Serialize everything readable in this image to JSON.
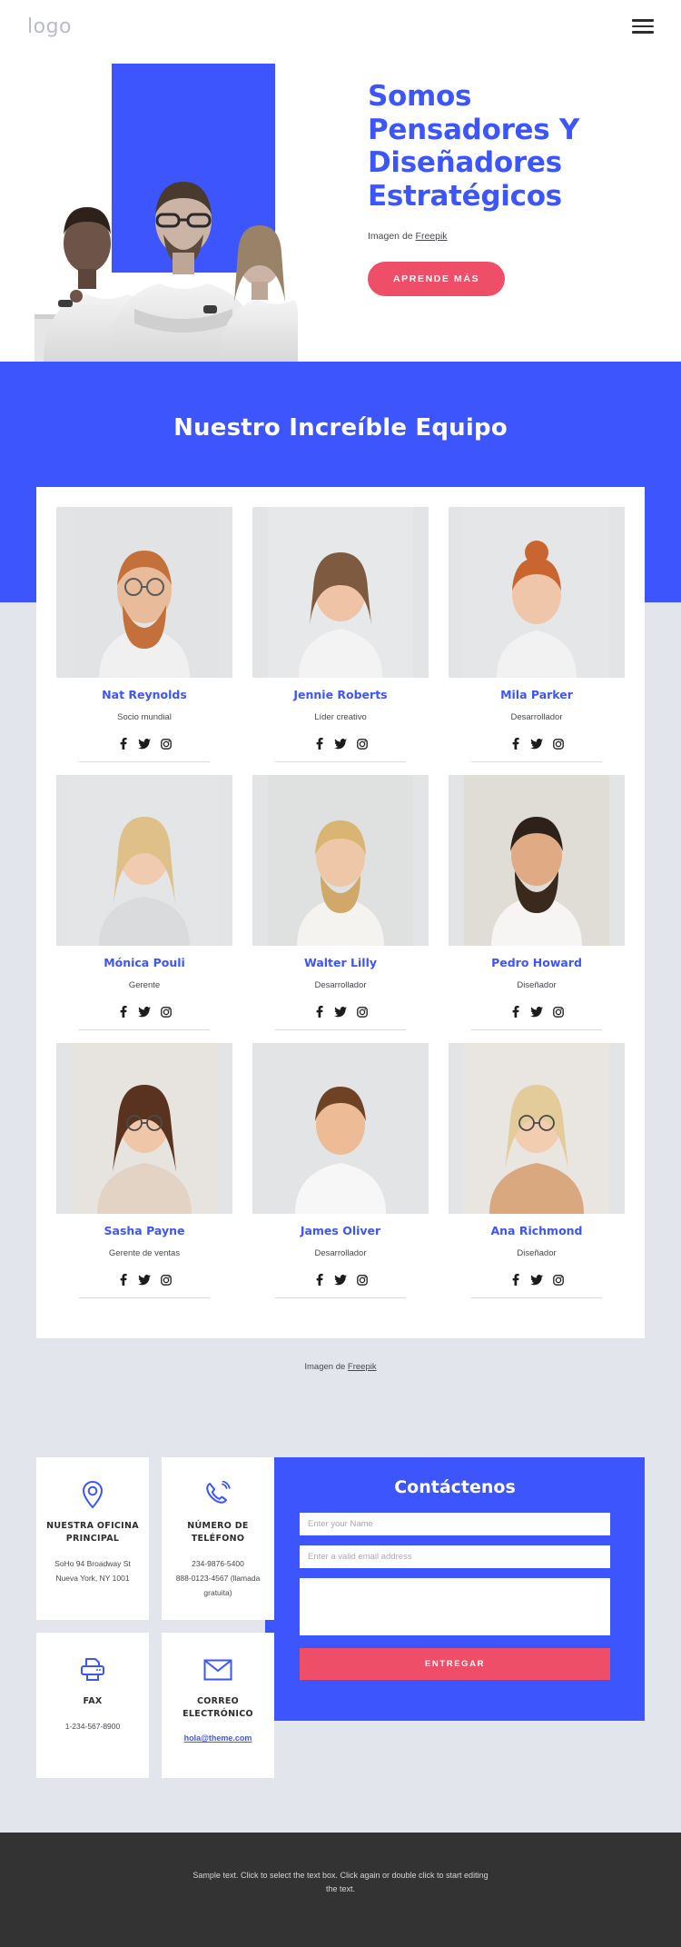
{
  "header": {
    "logo": "logo",
    "menu_icon": "hamburger-menu-icon"
  },
  "hero": {
    "title": "Somos Pensadores Y Diseñadores Estratégicos",
    "credit_prefix": "Imagen de ",
    "credit_link": "Freepik",
    "cta_label": "APRENDE MÁS"
  },
  "team": {
    "heading": "Nuestro Increíble Equipo",
    "credit_prefix": "Imagen de ",
    "credit_link": "Freepik",
    "social_icons": [
      "facebook-icon",
      "twitter-icon",
      "instagram-icon"
    ],
    "rows": [
      [
        {
          "name": "Nat Reynolds",
          "role": "Socio mundial"
        },
        {
          "name": "Jennie Roberts",
          "role": "Líder creativo"
        },
        {
          "name": "Mila Parker",
          "role": "Desarrollador"
        }
      ],
      [
        {
          "name": "Mónica Pouli",
          "role": "Gerente"
        },
        {
          "name": "Walter Lilly",
          "role": "Desarrollador"
        },
        {
          "name": "Pedro Howard",
          "role": "Diseñador"
        }
      ],
      [
        {
          "name": "Sasha Payne",
          "role": "Gerente de ventas"
        },
        {
          "name": "James Oliver",
          "role": "Desarrollador"
        },
        {
          "name": "Ana Richmond",
          "role": "Diseñador"
        }
      ]
    ]
  },
  "contact": {
    "cards": [
      {
        "icon": "location-pin-icon",
        "title": "NUESTRA OFICINA PRINCIPAL",
        "lines": [
          "SoHo 94 Broadway St",
          "Nueva York, NY 1001"
        ]
      },
      {
        "icon": "phone-icon",
        "title": "NÚMERO DE TELÉFONO",
        "lines": [
          "234-9876-5400",
          "888-0123-4567 (llamada gratuita)"
        ]
      },
      {
        "icon": "printer-icon",
        "title": "FAX",
        "lines": [
          "1-234-567-8900"
        ]
      },
      {
        "icon": "envelope-icon",
        "title": "CORREO ELECTRÓNICO",
        "lines": [],
        "link": "hola@theme.com"
      }
    ],
    "form": {
      "title": "Contáctenos",
      "name_placeholder": "Enter your Name",
      "email_placeholder": "Enter a valid email address",
      "message_placeholder": "",
      "submit_label": "ENTREGAR"
    }
  },
  "footer": {
    "text": "Sample text. Click to select the text box. Click again or double click to start editing the text."
  },
  "colors": {
    "brand_blue": "#3c55fc",
    "accent_pink": "#ef4e69",
    "page_bg": "#e2e6ec",
    "footer_bg": "#333333"
  }
}
